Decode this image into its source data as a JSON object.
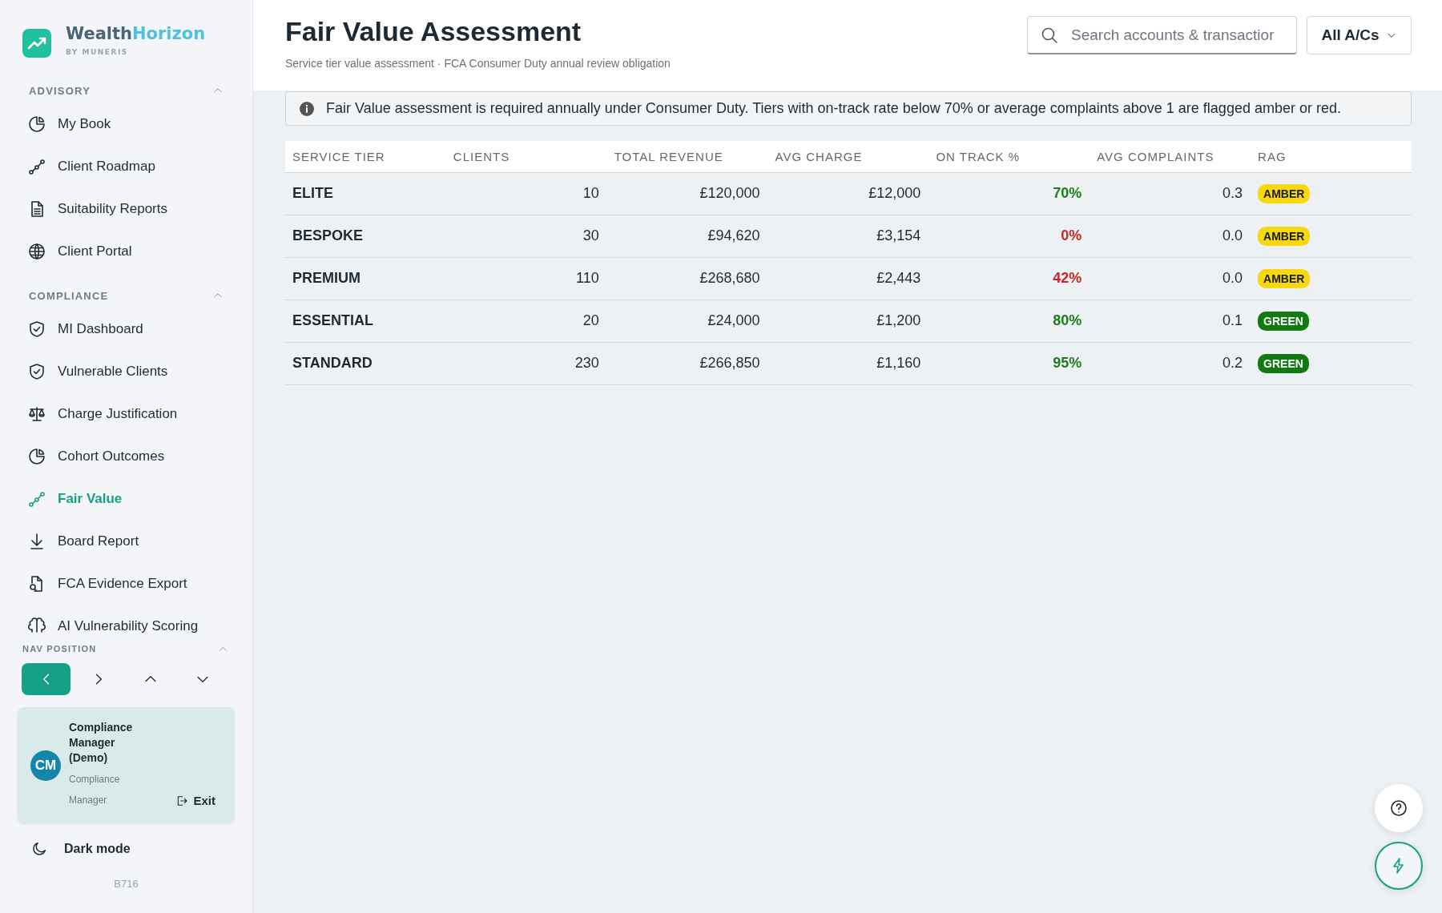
{
  "brand": {
    "name_dark": "Wealth",
    "name_light": "Horizon",
    "tagline": "BY MUNERIS"
  },
  "nav_sections": [
    {
      "title": "ADVISORY",
      "expanded": true,
      "items": [
        {
          "label": "My Book",
          "selected": false
        },
        {
          "label": "Client Roadmap",
          "selected": false
        },
        {
          "label": "Suitability Reports",
          "selected": false
        },
        {
          "label": "Client Portal",
          "selected": false
        }
      ]
    },
    {
      "title": "COMPLIANCE",
      "expanded": true,
      "items": [
        {
          "label": "MI Dashboard",
          "selected": false
        },
        {
          "label": "Vulnerable Clients",
          "selected": false
        },
        {
          "label": "Charge Justification",
          "selected": false
        },
        {
          "label": "Cohort Outcomes",
          "selected": false
        },
        {
          "label": "Fair Value",
          "selected": true
        },
        {
          "label": "Board Report",
          "selected": false
        },
        {
          "label": "FCA Evidence Export",
          "selected": false
        },
        {
          "label": "AI Vulnerability Scoring",
          "selected": false
        }
      ]
    }
  ],
  "nav_position": {
    "title": "NAV POSITION",
    "expanded": true,
    "options": [
      {
        "selected": true
      },
      {
        "selected": false
      },
      {
        "selected": false
      },
      {
        "selected": false
      }
    ]
  },
  "user": {
    "initials": "CM",
    "name": "Compliance Manager (Demo)",
    "role": "Compliance Manager",
    "exit_label": "Exit"
  },
  "dark_mode": {
    "label": "Dark mode"
  },
  "build": "B716",
  "page": {
    "title": "Fair Value Assessment",
    "subtitle": "Service tier value assessment · FCA Consumer Duty annual review obligation"
  },
  "search": {
    "placeholder": "Search accounts & transactior"
  },
  "account_filter": {
    "label": "All A/Cs"
  },
  "banner": {
    "text": "Fair Value assessment is required annually under Consumer Duty. Tiers with on-track rate below 70% or average complaints above 1 are flagged amber or red."
  },
  "table": {
    "columns": [
      "SERVICE TIER",
      "CLIENTS",
      "TOTAL REVENUE",
      "AVG CHARGE",
      "ON TRACK %",
      "AVG COMPLAINTS",
      "RAG"
    ],
    "rows": [
      {
        "tier": "ELITE",
        "clients": "10",
        "total_revenue": "£120,000",
        "avg_charge": "£12,000",
        "on_track": {
          "value": "70%",
          "color": "#1a7f1a"
        },
        "avg_complaints": "0.3",
        "rag": {
          "label": "AMBER",
          "color": "#f5d90a"
        }
      },
      {
        "tier": "BESPOKE",
        "clients": "30",
        "total_revenue": "£94,620",
        "avg_charge": "£3,154",
        "on_track": {
          "value": "0%",
          "color": "#c62828"
        },
        "avg_complaints": "0.0",
        "rag": {
          "label": "AMBER",
          "color": "#f5d90a"
        }
      },
      {
        "tier": "PREMIUM",
        "clients": "110",
        "total_revenue": "£268,680",
        "avg_charge": "£2,443",
        "on_track": {
          "value": "42%",
          "color": "#c62828"
        },
        "avg_complaints": "0.0",
        "rag": {
          "label": "AMBER",
          "color": "#f5d90a"
        }
      },
      {
        "tier": "ESSENTIAL",
        "clients": "20",
        "total_revenue": "£24,000",
        "avg_charge": "£1,200",
        "on_track": {
          "value": "80%",
          "color": "#1a7f1a"
        },
        "avg_complaints": "0.1",
        "rag": {
          "label": "GREEN",
          "color": "#137a13"
        }
      },
      {
        "tier": "STANDARD",
        "clients": "230",
        "total_revenue": "£266,850",
        "avg_charge": "£1,160",
        "on_track": {
          "value": "95%",
          "color": "#1a7f1a"
        },
        "avg_complaints": "0.2",
        "rag": {
          "label": "GREEN",
          "color": "#137a13"
        }
      }
    ]
  }
}
